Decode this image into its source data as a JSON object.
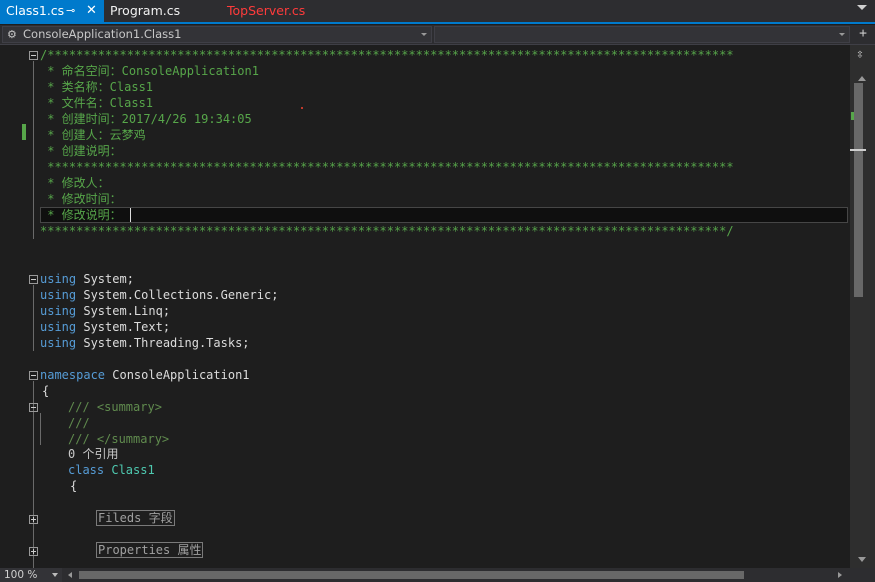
{
  "tabs": {
    "active": {
      "label": "Class1.cs",
      "pin_icon": "pin-icon",
      "close_icon": "close-icon"
    },
    "second": {
      "label": "Program.cs"
    },
    "third": {
      "label": "TopServer.cs"
    }
  },
  "navbar": {
    "class_selector": "ConsoleApplication1.Class1",
    "class_icon": "class-hierarchy-icon",
    "add_icon": "split-plus-icon"
  },
  "code": {
    "header": {
      "top_border": "/***********************************************************************************************",
      "namespace_line": " * 命名空间：ConsoleApplication1",
      "class_line": " * 类名称：Class1",
      "file_line": " * 文件名：Class1",
      "created_time_line": " * 创建时间：2017/4/26 19:34:05",
      "creator_line": " * 创建人：云梦鸡",
      "created_desc_line": " * 创建说明：",
      "mid_border": " ***********************************************************************************************",
      "modifier_line": " * 修改人：",
      "modified_time_line": " * 修改时间：",
      "modified_desc_line": " * 修改说明：",
      "bottom_border": "***********************************************************************************************/"
    },
    "usings": [
      {
        "kw": "using",
        "name": " System;"
      },
      {
        "kw": "using",
        "name": " System.Collections.Generic;"
      },
      {
        "kw": "using",
        "name": " System.Linq;"
      },
      {
        "kw": "using",
        "name": " System.Text;"
      },
      {
        "kw": "using",
        "name": " System.Threading.Tasks;"
      }
    ],
    "namespace_kw": "namespace",
    "namespace_name": " ConsoleApplication1",
    "open_brace": "{",
    "doc_summary_open": "/// <summary>",
    "doc_empty": "///",
    "doc_summary_close": "/// </summary>",
    "references": "0 个引用",
    "class_kw": "class",
    "class_name": " Class1",
    "class_brace": "{",
    "region_fields": "Fileds 字段",
    "region_properties": "Properties 属性"
  },
  "statusbar": {
    "zoom": "100 %"
  },
  "colors": {
    "background": "#1e1e1e",
    "comment": "#57a64a",
    "keyword": "#569cd6",
    "type": "#4ec9b0",
    "accent": "#007acc"
  }
}
